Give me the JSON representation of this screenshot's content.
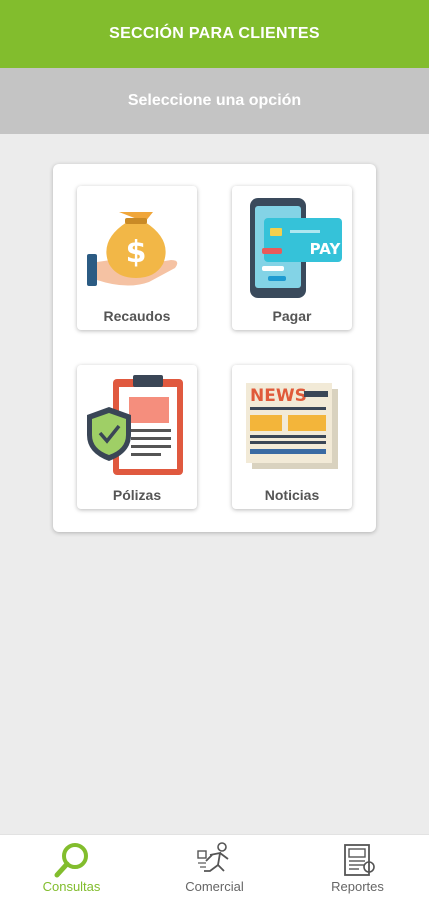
{
  "header": {
    "title": "SECCIÓN PARA CLIENTES"
  },
  "subheader": {
    "text": "Seleccione una opción"
  },
  "options": [
    {
      "label": "Recaudos",
      "icon": "money-bag-icon"
    },
    {
      "label": "Pagar",
      "icon": "mobile-pay-icon"
    },
    {
      "label": "Pólizas",
      "icon": "policy-shield-icon"
    },
    {
      "label": "Noticias",
      "icon": "newspaper-icon"
    }
  ],
  "pay_card_text": "PAY",
  "news_text": "NEWS",
  "bottom_nav": {
    "active": "Consultas",
    "items": [
      {
        "label": "Consultas",
        "icon": "search-icon"
      },
      {
        "label": "Comercial",
        "icon": "runner-icon"
      },
      {
        "label": "Reportes",
        "icon": "report-icon"
      }
    ]
  },
  "colors": {
    "primary": "#82bd2d",
    "subheader": "#c4c4c4",
    "background": "#ececec"
  }
}
